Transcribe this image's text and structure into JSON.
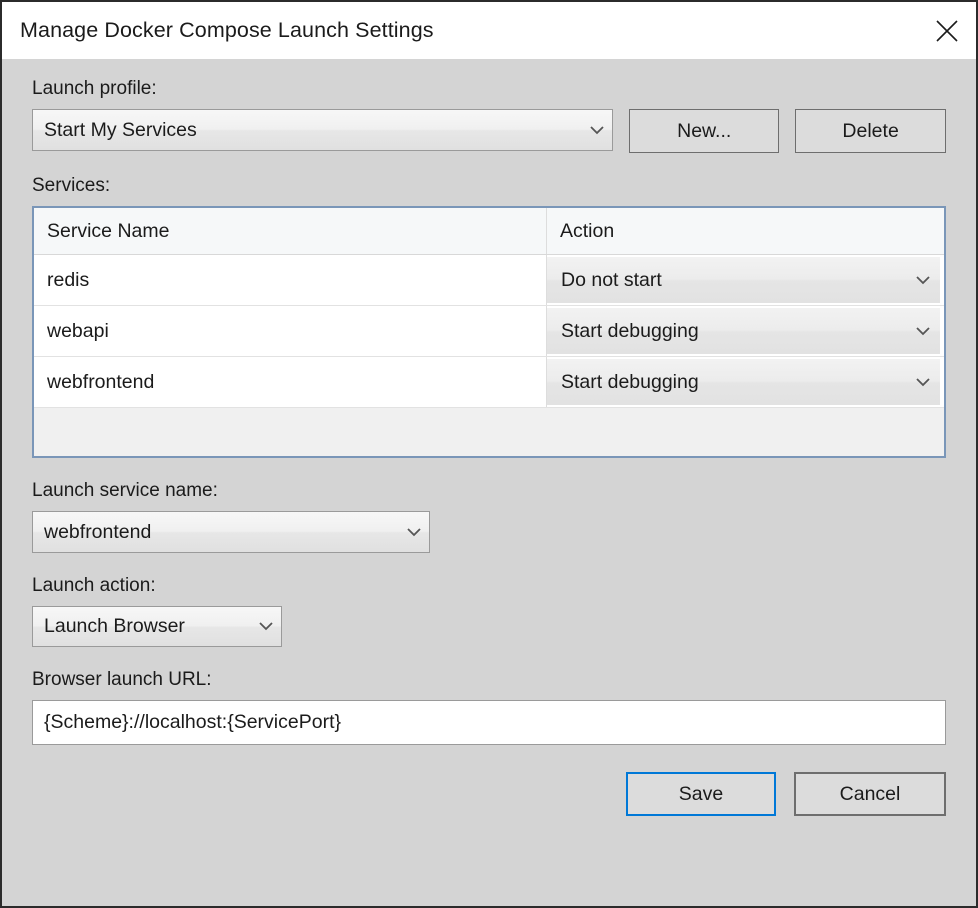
{
  "window": {
    "title": "Manage Docker Compose Launch Settings",
    "close_icon": "close-icon"
  },
  "launch_profile": {
    "label": "Launch profile:",
    "value": "Start My Services",
    "chevron_icon": "chevron-down-icon",
    "new_button": "New...",
    "delete_button": "Delete"
  },
  "services": {
    "label": "Services:",
    "columns": [
      "Service Name",
      "Action"
    ],
    "rows": [
      {
        "name": "redis",
        "action": "Do not start"
      },
      {
        "name": "webapi",
        "action": "Start debugging"
      },
      {
        "name": "webfrontend",
        "action": "Start debugging"
      }
    ]
  },
  "launch_service_name": {
    "label": "Launch service name:",
    "value": "webfrontend"
  },
  "launch_action": {
    "label": "Launch action:",
    "value": "Launch Browser"
  },
  "browser_url": {
    "label": "Browser launch URL:",
    "value": "{Scheme}://localhost:{ServicePort}"
  },
  "footer": {
    "save_label": "Save",
    "cancel_label": "Cancel"
  },
  "colors": {
    "dialog_background": "#d4d4d4",
    "titlebar_background": "#ffffff",
    "grid_border": "#7a96b8",
    "default_button_border": "#0078d7",
    "button_border": "#6e6e6e",
    "text": "#1b1b1b"
  }
}
